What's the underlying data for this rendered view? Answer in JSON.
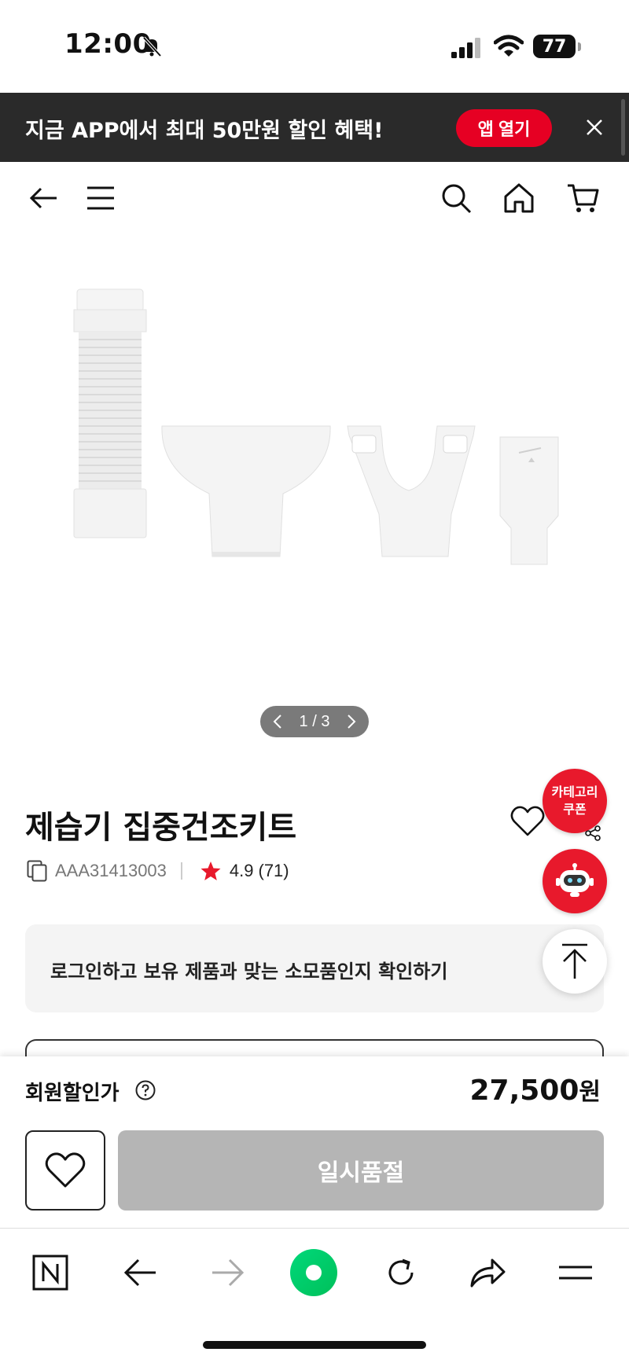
{
  "status_bar": {
    "time": "12:00",
    "battery": "77"
  },
  "app_banner": {
    "text": "지금 APP에서 최대 50만원 할인 혜택!",
    "open_button": "앱 열기"
  },
  "nav": {
    "icons": [
      "back-arrow-icon",
      "menu-icon",
      "search-icon",
      "home-icon",
      "cart-icon"
    ]
  },
  "gallery": {
    "pager_text": "1 / 3",
    "current": 1,
    "total": 3
  },
  "product": {
    "title": "제습기 집중건조키트",
    "code": "AAA31413003",
    "rating": "4.9",
    "review_count": "(71)"
  },
  "floating": {
    "coupon_line1": "카테고리",
    "coupon_line2": "쿠폰"
  },
  "login_prompt": "로그인하고 보유 제품과 맞는 소모품인지 확인하기",
  "purchase": {
    "price_label": "회원할인가",
    "price": "27,500",
    "currency": "원",
    "soldout_label": "일시품절"
  },
  "colors": {
    "accent_red": "#e60023",
    "banner_bg": "#2a2a2a",
    "soldout_gray": "#b5b5b5",
    "naver_green": "#03c75a"
  }
}
